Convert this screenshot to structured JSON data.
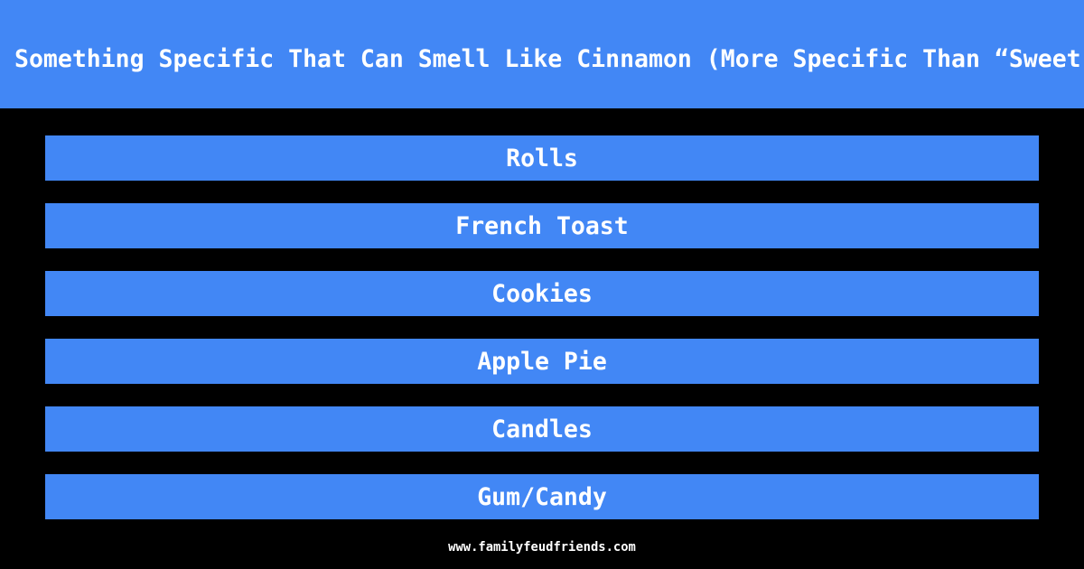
{
  "header": {
    "title": "Something Specific That Can Smell Like Cinnamon (More Specific Than “Sweet"
  },
  "answers": [
    {
      "label": "Rolls"
    },
    {
      "label": "French Toast"
    },
    {
      "label": "Cookies"
    },
    {
      "label": "Apple Pie"
    },
    {
      "label": "Candles"
    },
    {
      "label": "Gum/Candy"
    }
  ],
  "footer": {
    "url": "www.familyfeudfriends.com"
  },
  "colors": {
    "accent": "#4287f5",
    "background": "#000000",
    "text": "#ffffff"
  }
}
